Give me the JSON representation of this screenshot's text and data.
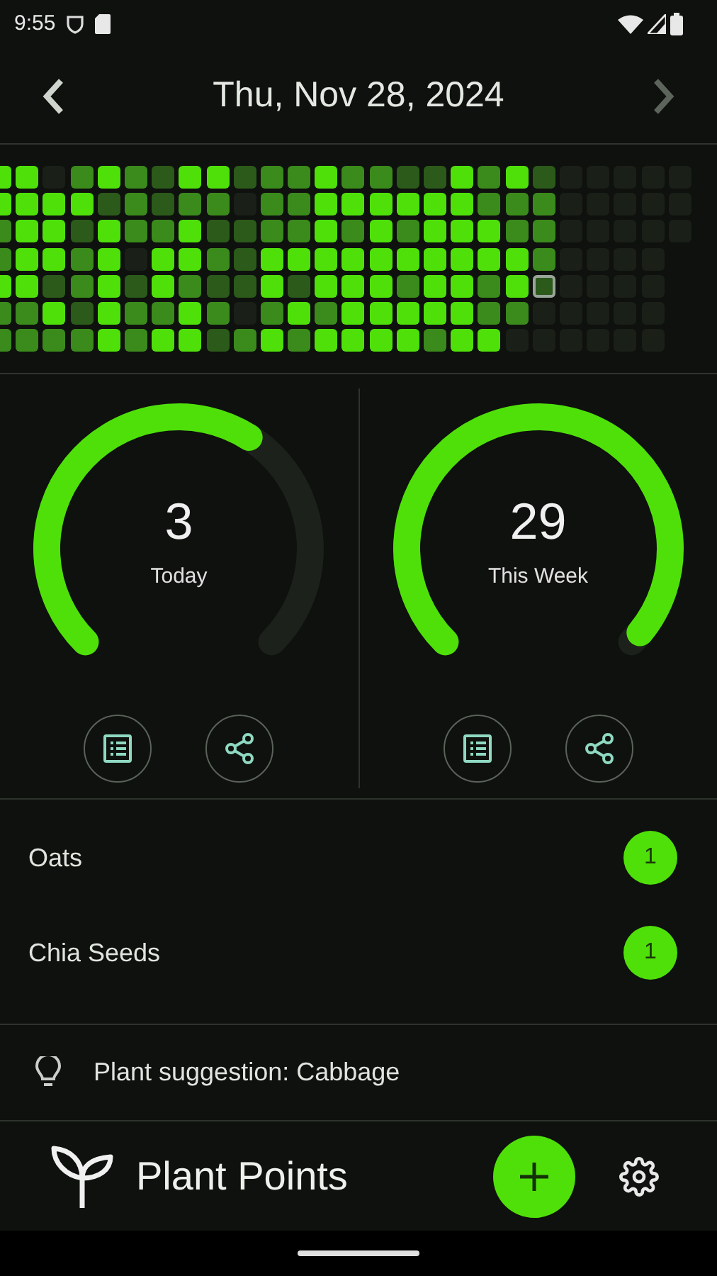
{
  "status_bar": {
    "time": "9:55"
  },
  "header": {
    "date": "Thu, Nov 28, 2024",
    "prev": {
      "disabled": false
    },
    "next": {
      "disabled": true
    }
  },
  "heatmap": {
    "rows": [
      {
        "cells": [
          {
            "kind": "high",
            "selected": false
          },
          {
            "kind": "high",
            "selected": false
          },
          {
            "kind": "none",
            "selected": false
          },
          {
            "kind": "mid",
            "selected": false
          },
          {
            "kind": "high",
            "selected": false
          },
          {
            "kind": "mid",
            "selected": false
          },
          {
            "kind": "low",
            "selected": false
          },
          {
            "kind": "high",
            "selected": false
          },
          {
            "kind": "high",
            "selected": false
          },
          {
            "kind": "low",
            "selected": false
          },
          {
            "kind": "mid",
            "selected": false
          },
          {
            "kind": "mid",
            "selected": false
          },
          {
            "kind": "high",
            "selected": false
          },
          {
            "kind": "mid",
            "selected": false
          },
          {
            "kind": "mid",
            "selected": false
          },
          {
            "kind": "low",
            "selected": false
          },
          {
            "kind": "low",
            "selected": false
          },
          {
            "kind": "high",
            "selected": false
          },
          {
            "kind": "mid",
            "selected": false
          },
          {
            "kind": "high",
            "selected": false
          },
          {
            "kind": "low",
            "selected": false
          },
          {
            "kind": "none",
            "selected": false
          },
          {
            "kind": "none",
            "selected": false
          },
          {
            "kind": "none",
            "selected": false
          },
          {
            "kind": "none",
            "selected": false
          },
          {
            "kind": "none",
            "selected": false
          }
        ]
      },
      {
        "cells": [
          {
            "kind": "high",
            "selected": false
          },
          {
            "kind": "high",
            "selected": false
          },
          {
            "kind": "high",
            "selected": false
          },
          {
            "kind": "high",
            "selected": false
          },
          {
            "kind": "low",
            "selected": false
          },
          {
            "kind": "mid",
            "selected": false
          },
          {
            "kind": "low",
            "selected": false
          },
          {
            "kind": "mid",
            "selected": false
          },
          {
            "kind": "mid",
            "selected": false
          },
          {
            "kind": "none",
            "selected": false
          },
          {
            "kind": "mid",
            "selected": false
          },
          {
            "kind": "mid",
            "selected": false
          },
          {
            "kind": "high",
            "selected": false
          },
          {
            "kind": "high",
            "selected": false
          },
          {
            "kind": "high",
            "selected": false
          },
          {
            "kind": "high",
            "selected": false
          },
          {
            "kind": "high",
            "selected": false
          },
          {
            "kind": "high",
            "selected": false
          },
          {
            "kind": "mid",
            "selected": false
          },
          {
            "kind": "mid",
            "selected": false
          },
          {
            "kind": "mid",
            "selected": false
          },
          {
            "kind": "none",
            "selected": false
          },
          {
            "kind": "none",
            "selected": false
          },
          {
            "kind": "none",
            "selected": false
          },
          {
            "kind": "none",
            "selected": false
          },
          {
            "kind": "none",
            "selected": false
          }
        ]
      },
      {
        "cells": [
          {
            "kind": "mid",
            "selected": false
          },
          {
            "kind": "high",
            "selected": false
          },
          {
            "kind": "high",
            "selected": false
          },
          {
            "kind": "low",
            "selected": false
          },
          {
            "kind": "high",
            "selected": false
          },
          {
            "kind": "mid",
            "selected": false
          },
          {
            "kind": "mid",
            "selected": false
          },
          {
            "kind": "high",
            "selected": false
          },
          {
            "kind": "low",
            "selected": false
          },
          {
            "kind": "low",
            "selected": false
          },
          {
            "kind": "mid",
            "selected": false
          },
          {
            "kind": "mid",
            "selected": false
          },
          {
            "kind": "high",
            "selected": false
          },
          {
            "kind": "mid",
            "selected": false
          },
          {
            "kind": "high",
            "selected": false
          },
          {
            "kind": "mid",
            "selected": false
          },
          {
            "kind": "high",
            "selected": false
          },
          {
            "kind": "high",
            "selected": false
          },
          {
            "kind": "high",
            "selected": false
          },
          {
            "kind": "mid",
            "selected": false
          },
          {
            "kind": "mid",
            "selected": false
          },
          {
            "kind": "none",
            "selected": false
          },
          {
            "kind": "none",
            "selected": false
          },
          {
            "kind": "none",
            "selected": false
          },
          {
            "kind": "none",
            "selected": false
          },
          {
            "kind": "none",
            "selected": false
          }
        ]
      },
      {
        "cells": [
          {
            "kind": "mid",
            "selected": false
          },
          {
            "kind": "high",
            "selected": false
          },
          {
            "kind": "high",
            "selected": false
          },
          {
            "kind": "mid",
            "selected": false
          },
          {
            "kind": "high",
            "selected": false
          },
          {
            "kind": "none",
            "selected": false
          },
          {
            "kind": "high",
            "selected": false
          },
          {
            "kind": "high",
            "selected": false
          },
          {
            "kind": "mid",
            "selected": false
          },
          {
            "kind": "low",
            "selected": false
          },
          {
            "kind": "high",
            "selected": false
          },
          {
            "kind": "high",
            "selected": false
          },
          {
            "kind": "high",
            "selected": false
          },
          {
            "kind": "high",
            "selected": false
          },
          {
            "kind": "high",
            "selected": false
          },
          {
            "kind": "high",
            "selected": false
          },
          {
            "kind": "high",
            "selected": false
          },
          {
            "kind": "high",
            "selected": false
          },
          {
            "kind": "high",
            "selected": false
          },
          {
            "kind": "high",
            "selected": false
          },
          {
            "kind": "mid",
            "selected": false
          },
          {
            "kind": "none",
            "selected": false
          },
          {
            "kind": "none",
            "selected": false
          },
          {
            "kind": "none",
            "selected": false
          },
          {
            "kind": "none",
            "selected": false
          }
        ]
      },
      {
        "cells": [
          {
            "kind": "high",
            "selected": false
          },
          {
            "kind": "high",
            "selected": false
          },
          {
            "kind": "low",
            "selected": false
          },
          {
            "kind": "mid",
            "selected": false
          },
          {
            "kind": "high",
            "selected": false
          },
          {
            "kind": "low",
            "selected": false
          },
          {
            "kind": "high",
            "selected": false
          },
          {
            "kind": "mid",
            "selected": false
          },
          {
            "kind": "low",
            "selected": false
          },
          {
            "kind": "low",
            "selected": false
          },
          {
            "kind": "high",
            "selected": false
          },
          {
            "kind": "low",
            "selected": false
          },
          {
            "kind": "high",
            "selected": false
          },
          {
            "kind": "high",
            "selected": false
          },
          {
            "kind": "high",
            "selected": false
          },
          {
            "kind": "mid",
            "selected": false
          },
          {
            "kind": "high",
            "selected": false
          },
          {
            "kind": "high",
            "selected": false
          },
          {
            "kind": "mid",
            "selected": false
          },
          {
            "kind": "high",
            "selected": false
          },
          {
            "kind": "low",
            "selected": true
          },
          {
            "kind": "none",
            "selected": false
          },
          {
            "kind": "none",
            "selected": false
          },
          {
            "kind": "none",
            "selected": false
          },
          {
            "kind": "none",
            "selected": false
          }
        ]
      },
      {
        "cells": [
          {
            "kind": "mid",
            "selected": false
          },
          {
            "kind": "mid",
            "selected": false
          },
          {
            "kind": "high",
            "selected": false
          },
          {
            "kind": "low",
            "selected": false
          },
          {
            "kind": "high",
            "selected": false
          },
          {
            "kind": "mid",
            "selected": false
          },
          {
            "kind": "mid",
            "selected": false
          },
          {
            "kind": "high",
            "selected": false
          },
          {
            "kind": "mid",
            "selected": false
          },
          {
            "kind": "none",
            "selected": false
          },
          {
            "kind": "mid",
            "selected": false
          },
          {
            "kind": "high",
            "selected": false
          },
          {
            "kind": "mid",
            "selected": false
          },
          {
            "kind": "high",
            "selected": false
          },
          {
            "kind": "high",
            "selected": false
          },
          {
            "kind": "high",
            "selected": false
          },
          {
            "kind": "high",
            "selected": false
          },
          {
            "kind": "high",
            "selected": false
          },
          {
            "kind": "mid",
            "selected": false
          },
          {
            "kind": "mid",
            "selected": false
          },
          {
            "kind": "none",
            "selected": false
          },
          {
            "kind": "none",
            "selected": false
          },
          {
            "kind": "none",
            "selected": false
          },
          {
            "kind": "none",
            "selected": false
          },
          {
            "kind": "none",
            "selected": false
          }
        ]
      },
      {
        "cells": [
          {
            "kind": "mid",
            "selected": false
          },
          {
            "kind": "mid",
            "selected": false
          },
          {
            "kind": "mid",
            "selected": false
          },
          {
            "kind": "mid",
            "selected": false
          },
          {
            "kind": "high",
            "selected": false
          },
          {
            "kind": "mid",
            "selected": false
          },
          {
            "kind": "high",
            "selected": false
          },
          {
            "kind": "high",
            "selected": false
          },
          {
            "kind": "low",
            "selected": false
          },
          {
            "kind": "mid",
            "selected": false
          },
          {
            "kind": "high",
            "selected": false
          },
          {
            "kind": "mid",
            "selected": false
          },
          {
            "kind": "high",
            "selected": false
          },
          {
            "kind": "high",
            "selected": false
          },
          {
            "kind": "high",
            "selected": false
          },
          {
            "kind": "high",
            "selected": false
          },
          {
            "kind": "mid",
            "selected": false
          },
          {
            "kind": "high",
            "selected": false
          },
          {
            "kind": "high",
            "selected": false
          },
          {
            "kind": "none",
            "selected": false
          },
          {
            "kind": "none",
            "selected": false
          },
          {
            "kind": "none",
            "selected": false
          },
          {
            "kind": "none",
            "selected": false
          },
          {
            "kind": "none",
            "selected": false
          },
          {
            "kind": "none",
            "selected": false
          }
        ]
      }
    ]
  },
  "gauges": [
    {
      "value": "3",
      "label": "Today"
    },
    {
      "value": "29",
      "label": "This Week"
    }
  ],
  "plants": [
    {
      "name": "Oats",
      "count": "1"
    },
    {
      "name": "Chia Seeds",
      "count": "1"
    }
  ],
  "suggestion": "Plant suggestion: Cabbage",
  "app_bar": {
    "title": "Plant Points"
  }
}
